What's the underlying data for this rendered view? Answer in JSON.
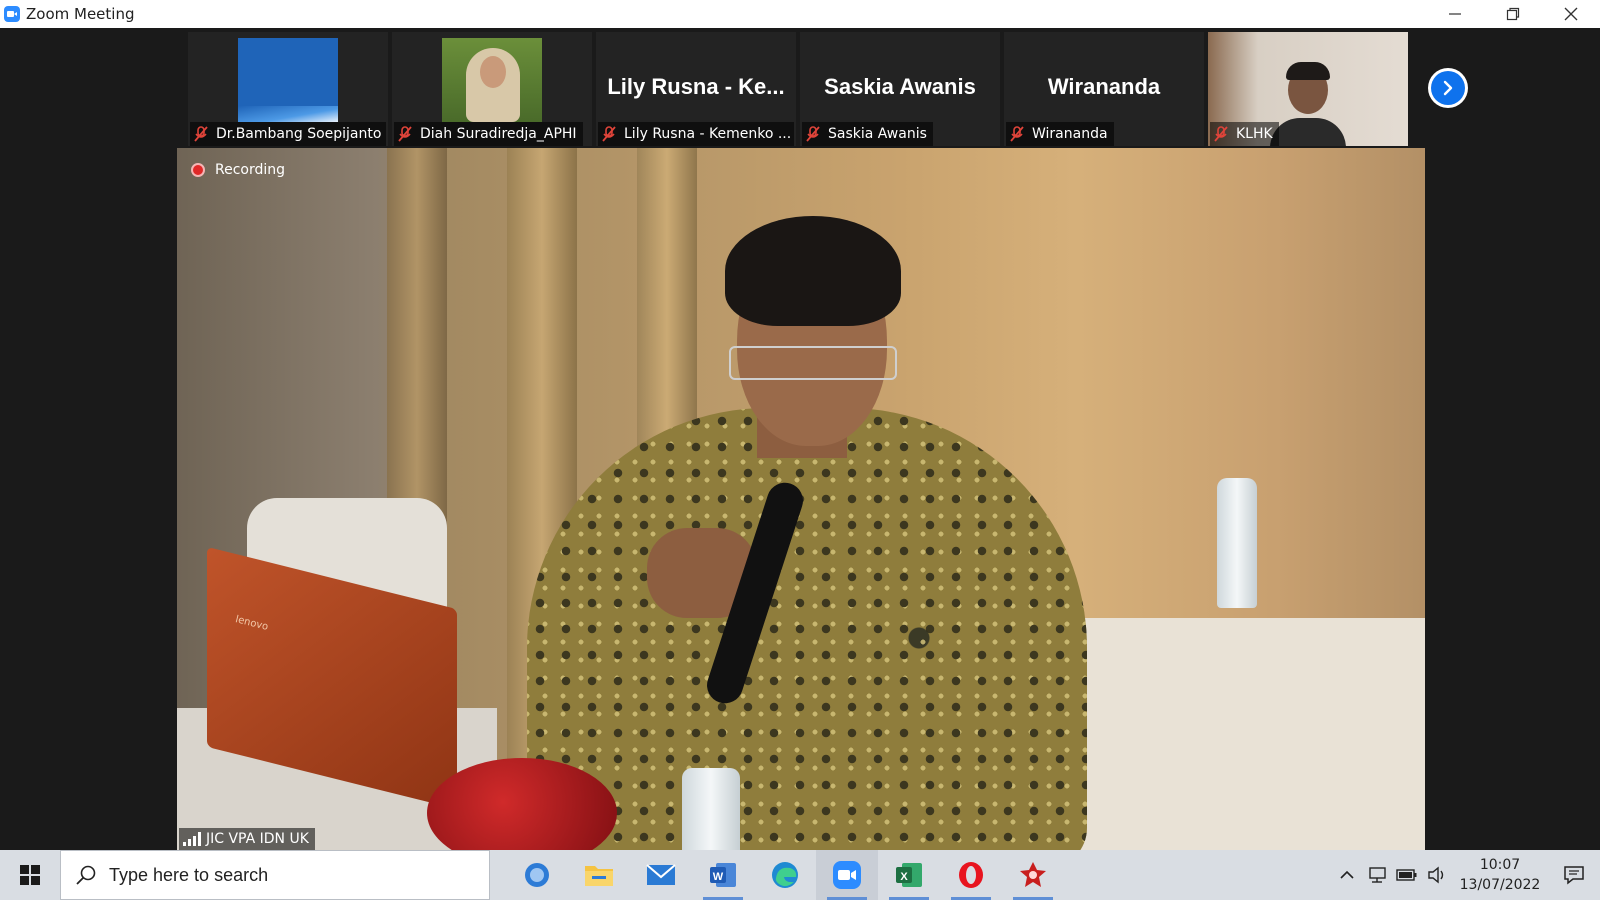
{
  "window": {
    "title": "Zoom Meeting"
  },
  "thumbnails": [
    {
      "label": "Dr.Bambang Soepijanto",
      "big_name": ""
    },
    {
      "label": "Diah Suradiredja_APHI",
      "big_name": ""
    },
    {
      "label": "Lily Rusna - Kemenko ...",
      "big_name": "Lily Rusna - Ke..."
    },
    {
      "label": "Saskia Awanis",
      "big_name": "Saskia Awanis"
    },
    {
      "label": "Wirananda",
      "big_name": "Wirananda"
    },
    {
      "label": "KLHK",
      "big_name": ""
    }
  ],
  "main_video": {
    "recording_label": "Recording",
    "speaker_name": "JIC VPA IDN UK",
    "laptop_brand": "lenovo"
  },
  "taskbar": {
    "search_placeholder": "Type here to search",
    "clock_time": "10:07",
    "clock_date": "13/07/2022"
  },
  "colors": {
    "zoom_blue": "#0e72ed",
    "recording_red": "#e02828",
    "mute_red": "#e0443a"
  }
}
